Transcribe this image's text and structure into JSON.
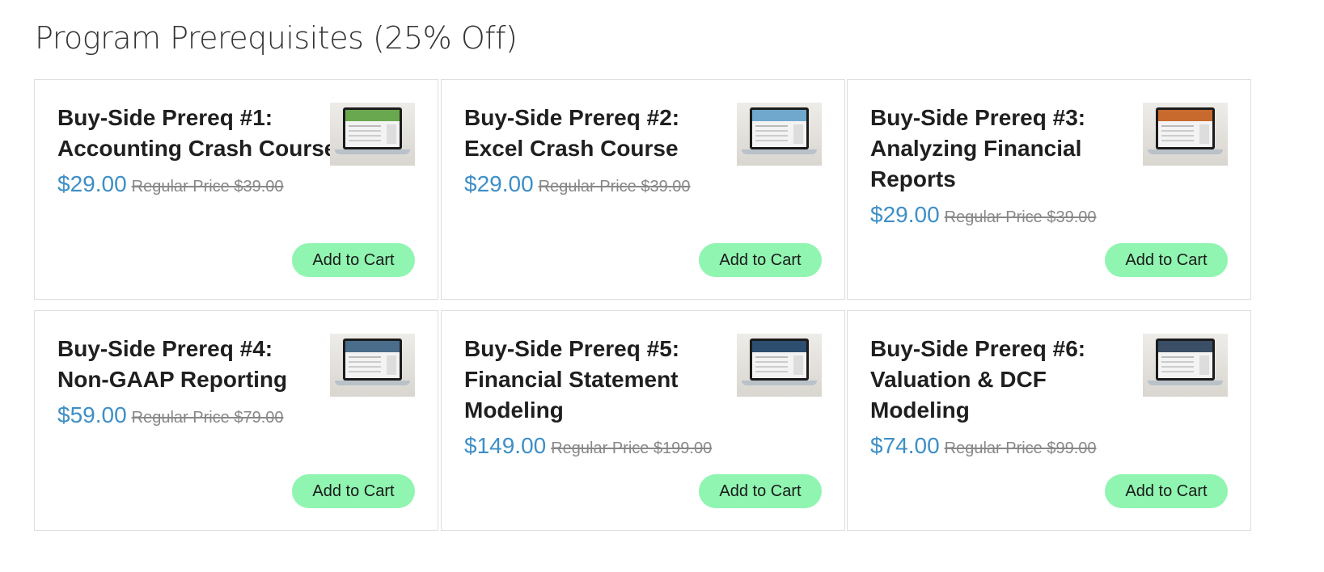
{
  "section": {
    "title": "Program Prerequisites (25% Off)"
  },
  "products": [
    {
      "title_lines": [
        "Buy-Side Prereq #1:",
        "Accounting Crash Course"
      ],
      "price": "$29.00",
      "regular_price": "Regular Price $39.00",
      "button": "Add to Cart",
      "thumb_color": "#6aa84f"
    },
    {
      "title_lines": [
        "Buy-Side Prereq #2:",
        "Excel Crash Course"
      ],
      "price": "$29.00",
      "regular_price": "Regular Price $39.00",
      "button": "Add to Cart",
      "thumb_color": "#6fa8cc"
    },
    {
      "title_lines": [
        "Buy-Side Prereq #3:",
        "Analyzing Financial",
        "Reports"
      ],
      "price": "$29.00",
      "regular_price": "Regular Price $39.00",
      "button": "Add to Cart",
      "thumb_color": "#c8692e"
    },
    {
      "title_lines": [
        "Buy-Side Prereq #4:",
        "Non-GAAP Reporting"
      ],
      "price": "$59.00",
      "regular_price": "Regular Price $79.00",
      "button": "Add to Cart",
      "thumb_color": "#4a6d8c"
    },
    {
      "title_lines": [
        "Buy-Side Prereq #5:",
        "Financial Statement",
        "Modeling"
      ],
      "price": "$149.00",
      "regular_price": "Regular Price $199.00",
      "button": "Add to Cart",
      "thumb_color": "#2d4e6e"
    },
    {
      "title_lines": [
        "Buy-Side Prereq #6:",
        "Valuation & DCF",
        "Modeling"
      ],
      "price": "$74.00",
      "regular_price": "Regular Price $99.00",
      "button": "Add to Cart",
      "thumb_color": "#3a4f66"
    }
  ]
}
